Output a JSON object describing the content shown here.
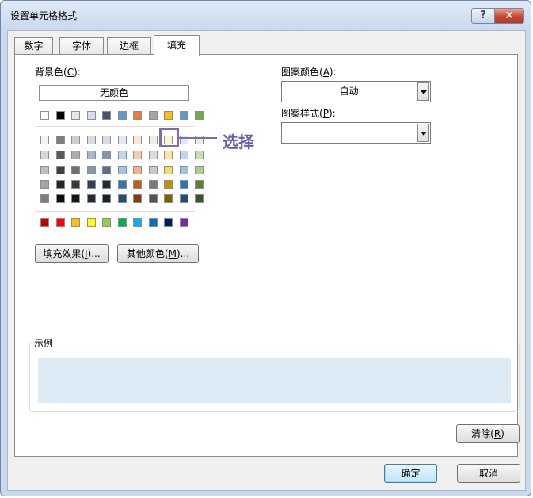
{
  "window": {
    "title": "设置单元格格式",
    "help_label": "?",
    "close_label": "✕"
  },
  "tabs": [
    {
      "label": "数字"
    },
    {
      "label": "字体"
    },
    {
      "label": "边框"
    },
    {
      "label": "填充"
    }
  ],
  "background": {
    "label_text": "背景色(",
    "label_key": "C",
    "label_end": "):",
    "no_color_label": "无颜色",
    "theme_top_row": [
      "#ffffff",
      "#000000",
      "#e7e6e6",
      "#d5dde8",
      "#44546a",
      "#5b9bd5",
      "#ed7d31",
      "#a5a5a5",
      "#ffc000",
      "#5b9bd5",
      "#70ad47"
    ],
    "theme_shades": [
      [
        "#f2f2f2",
        "#7f7f7f",
        "#d0cece",
        "#d6dce4",
        "#d6dce4",
        "#deebf6",
        "#fbe5d5",
        "#ededed",
        "#fff2cc",
        "#ddebf7",
        "#e2efd9"
      ],
      [
        "#d8d8d8",
        "#595959",
        "#aeabab",
        "#acb9ca",
        "#8496b0",
        "#bdd7ee",
        "#f8cbad",
        "#dbdbdb",
        "#ffe599",
        "#bdd7ee",
        "#c5e0b3"
      ],
      [
        "#bfbfbf",
        "#3f3f3f",
        "#757070",
        "#8497b0",
        "#5b6f8c",
        "#9dc3e6",
        "#f4b183",
        "#c9c9c9",
        "#ffd966",
        "#9cc3e5",
        "#a8d08d"
      ],
      [
        "#a5a5a5",
        "#262626",
        "#3a3838",
        "#323f4f",
        "#222a35",
        "#2e75b5",
        "#c55a11",
        "#7b7b7b",
        "#bf9000",
        "#2e75b5",
        "#538135"
      ],
      [
        "#7f7f7f",
        "#0c0c0c",
        "#171616",
        "#222a35",
        "#16202a",
        "#1f4e79",
        "#843c0c",
        "#525252",
        "#7f6000",
        "#1f4e79",
        "#375623"
      ]
    ],
    "standard_colors": [
      "#c00000",
      "#ff0000",
      "#ffc000",
      "#ffff00",
      "#92d050",
      "#00b050",
      "#00b0f0",
      "#0070c0",
      "#002060",
      "#7030a0"
    ],
    "fill_effects_text": "填充效果(",
    "fill_effects_key": "I",
    "fill_effects_end": ")...",
    "more_colors_text": "其他颜色(",
    "more_colors_key": "M",
    "more_colors_end": ")..."
  },
  "annotation": {
    "text": "选择",
    "color": "#6d5ca8"
  },
  "pattern_color": {
    "label_text": "图案颜色(",
    "label_key": "A",
    "label_end": "):",
    "value": "自动"
  },
  "pattern_style": {
    "label_text": "图案样式(",
    "label_key": "P",
    "label_end": "):",
    "value": ""
  },
  "sample": {
    "label": "示例",
    "fill_color": "#ddebf7"
  },
  "clear_button": {
    "text": "清除(",
    "key": "R",
    "end": ")"
  },
  "footer": {
    "ok_label": "确定",
    "cancel_label": "取消"
  }
}
